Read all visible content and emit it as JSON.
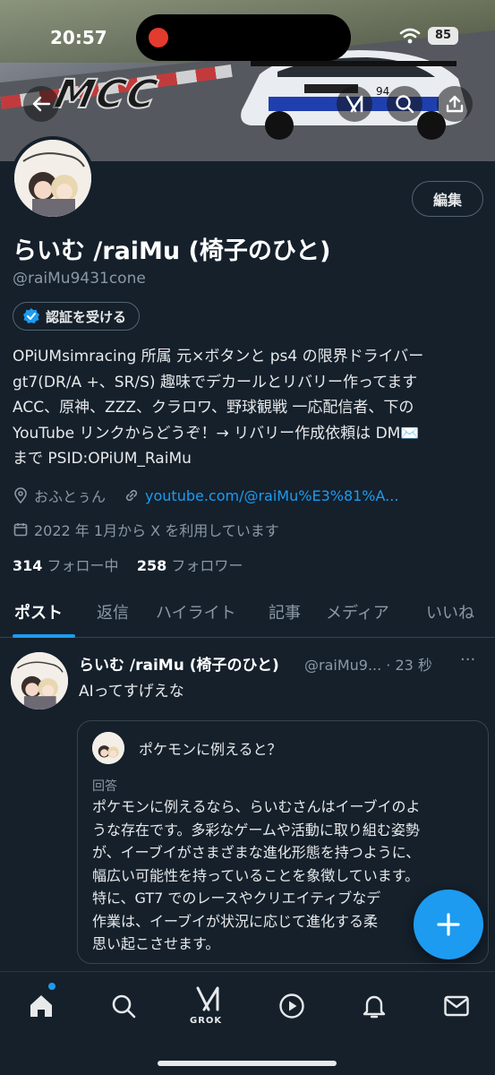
{
  "status_bar": {
    "time": "20:57",
    "battery": "85"
  },
  "banner": {
    "logo_text": "MCC",
    "car_number": "94"
  },
  "header_actions": {
    "back_icon": "arrow-left-icon",
    "grok_icon": "grok-icon",
    "search_icon": "search-icon",
    "share_icon": "share-icon"
  },
  "profile": {
    "edit_label": "編集",
    "display_name": "らいむ /raiMu (椅子のひと)",
    "handle": "@raiMu9431cone",
    "verify_label": "認証を受ける",
    "bio_lines": [
      "OPiUMsimracing 所属 元×ボタンと ps4 の限界ドライバー",
      "gt7(DR/A +、SR/S) 趣味でデカールとリバリー作ってます",
      "ACC、原神、ZZZ、クラロワ、野球観戦 一応配信者、下の",
      "YouTube リンクからどうぞ！→ リバリー作成依頼は DM✉️",
      "まで PSID:OPiUM_RaiMu"
    ],
    "location": "おふとぅん",
    "website": "youtube.com/@raiMu%E3%81%A...",
    "joined": "2022 年 1月から X を利用しています",
    "following_count": "314",
    "following_label": "フォロー中",
    "followers_count": "258",
    "followers_label": "フォロワー"
  },
  "tabs": [
    "ポスト",
    "返信",
    "ハイライト",
    "記事",
    "メディア",
    "いいね"
  ],
  "post": {
    "author": "らいむ /raiMu (椅子のひと)",
    "handle_time": "@raiMu9... · 23 秒",
    "more": "···",
    "text": "AIってすげえな",
    "card": {
      "question": "ポケモンに例えると？",
      "label": "回答",
      "answer_lines": [
        "ポケモンに例えるなら、らいむさんはイーブイのよ",
        "うな存在です。多彩なゲームや活動に取り組む姿勢",
        "が、イーブイがさまざまな進化形態を持つように、",
        "幅広い可能性を持っていることを象徴しています。",
        "特に、GT7 でのレースやクリエイティブなデ",
        "作業は、イーブイが状況に応じて進化する柔",
        "思い起こさせます。"
      ]
    }
  },
  "bottom_nav": {
    "grok_label": "GROK"
  },
  "colors": {
    "background": "#15202b",
    "accent": "#1d9bf0",
    "muted": "#8b98a5"
  }
}
